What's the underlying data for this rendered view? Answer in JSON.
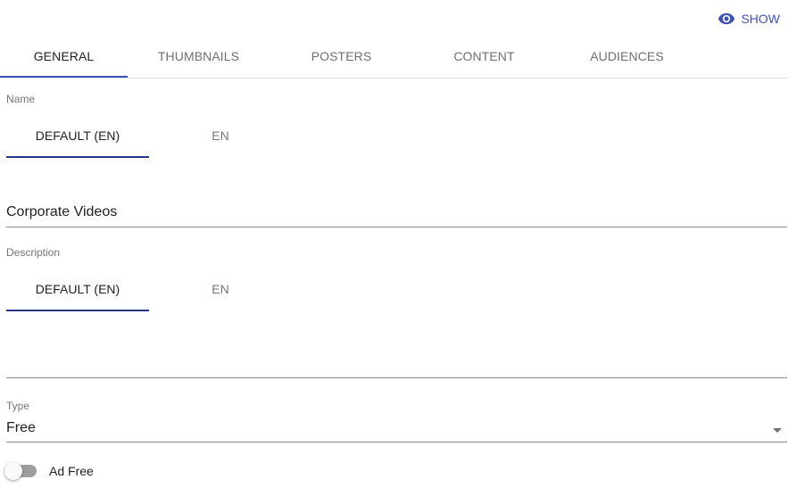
{
  "header": {
    "show_button": {
      "label": "SHOW",
      "icon": "eye-icon"
    }
  },
  "main_tabs": [
    {
      "label": "GENERAL",
      "active": true
    },
    {
      "label": "THUMBNAILS",
      "active": false
    },
    {
      "label": "POSTERS",
      "active": false
    },
    {
      "label": "CONTENT",
      "active": false
    },
    {
      "label": "AUDIENCES",
      "active": false
    }
  ],
  "name_field": {
    "label": "Name",
    "lang_tabs": [
      {
        "label": "DEFAULT (EN)",
        "active": true
      },
      {
        "label": "EN",
        "active": false
      }
    ],
    "value": "Corporate Videos"
  },
  "description_field": {
    "label": "Description",
    "lang_tabs": [
      {
        "label": "DEFAULT (EN)",
        "active": true
      },
      {
        "label": "EN",
        "active": false
      }
    ],
    "value": ""
  },
  "type_field": {
    "label": "Type",
    "value": "Free"
  },
  "ad_free_toggle": {
    "label": "Ad Free",
    "checked": false
  },
  "colors": {
    "accent": "#3f51b5",
    "lang_tab_indicator": "#283583"
  }
}
